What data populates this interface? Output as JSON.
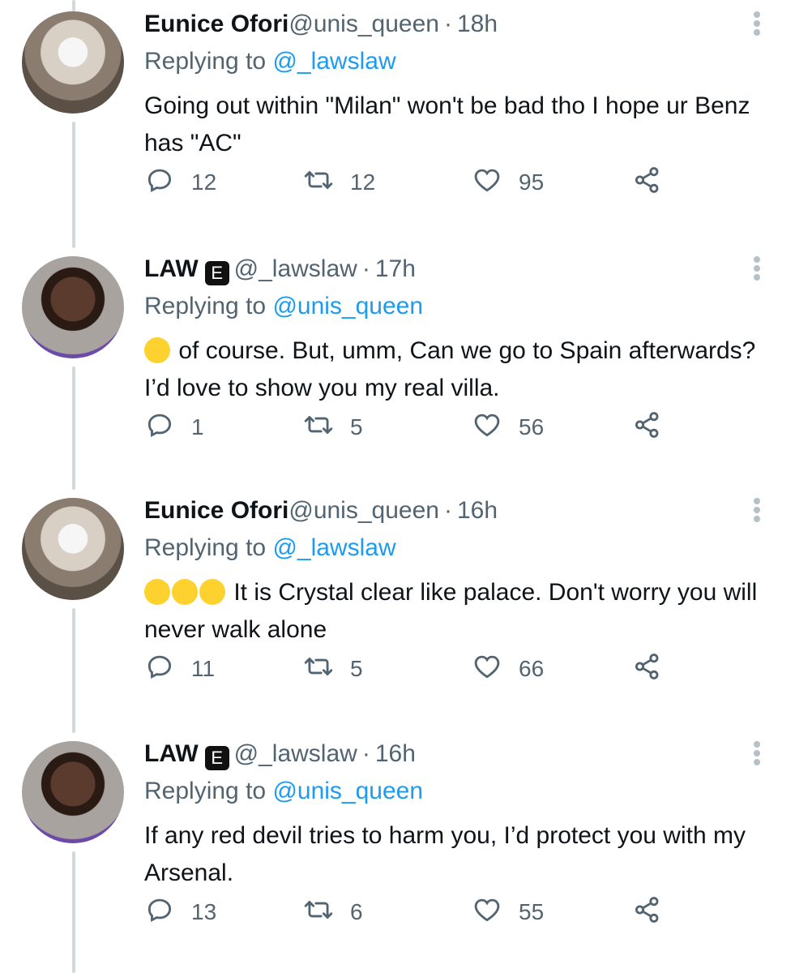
{
  "tweets": [
    {
      "name": "Eunice Ofori",
      "handle": "@unis_queen",
      "separator": "·",
      "time": "18h",
      "verified": "",
      "replying_prefix": "Replying to",
      "replying_to": "@_lawslaw",
      "text": "Going out within \"Milan\" won't be bad tho I hope ur Benz has \"AC\"",
      "emoji": "",
      "replies": "12",
      "retweets": "12",
      "likes": "95",
      "avatar": "eunice"
    },
    {
      "name": "LAW",
      "handle": "@_lawslaw",
      "separator": "·",
      "time": "17h",
      "verified": "E",
      "replying_prefix": "Replying to",
      "replying_to": "@unis_queen",
      "text": "of course. But, umm, Can we go to Spain afterwards? I’d love to show you my real villa.",
      "emoji": "😆",
      "replies": "1",
      "retweets": "5",
      "likes": "56",
      "avatar": "law"
    },
    {
      "name": "Eunice Ofori",
      "handle": "@unis_queen",
      "separator": "·",
      "time": "16h",
      "verified": "",
      "replying_prefix": "Replying to",
      "replying_to": "@_lawslaw",
      "text": "It is Crystal clear like palace. Don't worry you will never walk alone",
      "emoji": "😅😅😅",
      "replies": "11",
      "retweets": "5",
      "likes": "66",
      "avatar": "eunice"
    },
    {
      "name": "LAW",
      "handle": "@_lawslaw",
      "separator": "·",
      "time": "16h",
      "verified": "E",
      "replying_prefix": "Replying to",
      "replying_to": "@unis_queen",
      "text": "If any red devil tries to harm you, I’d protect you with my Arsenal.",
      "emoji": "",
      "replies": "13",
      "retweets": "6",
      "likes": "55",
      "avatar": "law"
    }
  ],
  "icons": {
    "reply": "reply-icon",
    "retweet": "retweet-icon",
    "like": "heart-icon",
    "share": "share-icon",
    "more": "more-icon"
  },
  "colors": {
    "text": "#0f1419",
    "secondary": "#536471",
    "link": "#1d9bf0",
    "thread_line": "#cfd9de"
  }
}
